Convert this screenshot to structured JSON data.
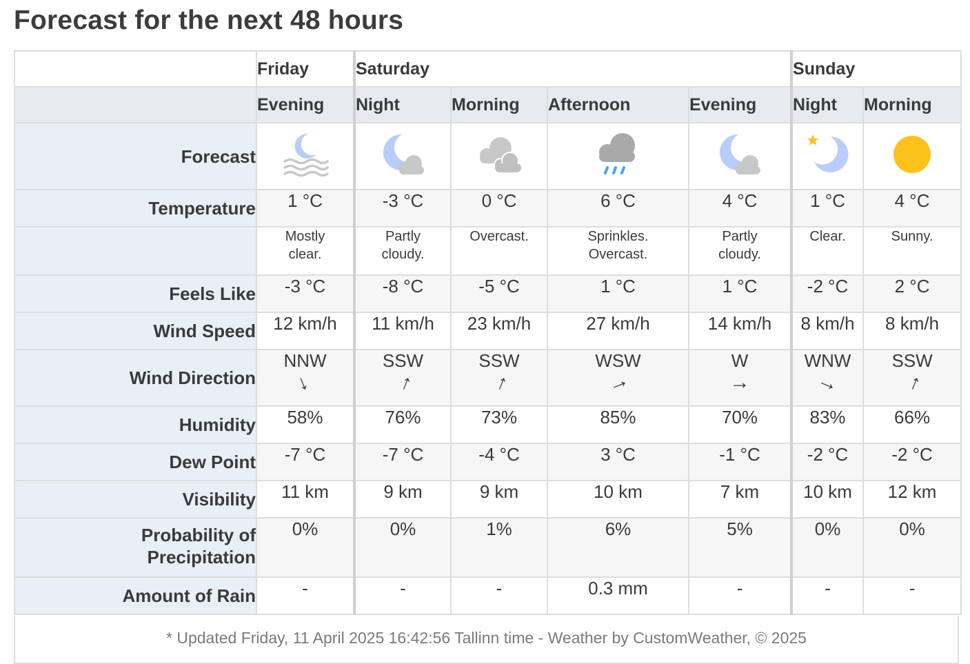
{
  "page": {
    "title": "Forecast for the next 48 hours"
  },
  "days": [
    {
      "label": "Friday"
    },
    {
      "label": "Saturday"
    },
    {
      "label": "Sunday"
    }
  ],
  "periods": [
    {
      "day": "Friday",
      "label": "Evening",
      "icon": "moon-fog-icon",
      "temperature": "1 °C",
      "condition_line1": "Mostly",
      "condition_line2": "clear.",
      "feels_like": "-3 °C",
      "wind_speed": "12 km/h",
      "wind_direction": "NNW",
      "wind_arrow": "→",
      "humidity": "58%",
      "dew_point": "-7 °C",
      "visibility": "11 km",
      "precip_prob": "0%",
      "rain_amount": "-"
    },
    {
      "day": "Saturday",
      "label": "Night",
      "icon": "moon-cloud-icon",
      "temperature": "-3 °C",
      "condition_line1": "Partly",
      "condition_line2": "cloudy.",
      "feels_like": "-8 °C",
      "wind_speed": "11 km/h",
      "wind_direction": "SSW",
      "wind_arrow": "→",
      "humidity": "76%",
      "dew_point": "-7 °C",
      "visibility": "9 km",
      "precip_prob": "0%",
      "rain_amount": "-"
    },
    {
      "day": "Saturday",
      "label": "Morning",
      "icon": "overcast-clouds-icon",
      "temperature": "0 °C",
      "condition_line1": "Overcast.",
      "condition_line2": "",
      "feels_like": "-5 °C",
      "wind_speed": "23 km/h",
      "wind_direction": "SSW",
      "wind_arrow": "→",
      "humidity": "73%",
      "dew_point": "-4 °C",
      "visibility": "9 km",
      "precip_prob": "1%",
      "rain_amount": "-"
    },
    {
      "day": "Saturday",
      "label": "Afternoon",
      "icon": "rain-cloud-icon",
      "temperature": "6 °C",
      "condition_line1": "Sprinkles.",
      "condition_line2": "Overcast.",
      "feels_like": "1 °C",
      "wind_speed": "27 km/h",
      "wind_direction": "WSW",
      "wind_arrow": "→",
      "humidity": "85%",
      "dew_point": "3 °C",
      "visibility": "10 km",
      "precip_prob": "6%",
      "rain_amount": "0.3 mm"
    },
    {
      "day": "Saturday",
      "label": "Evening",
      "icon": "moon-cloud-icon",
      "temperature": "4 °C",
      "condition_line1": "Partly",
      "condition_line2": "cloudy.",
      "feels_like": "1 °C",
      "wind_speed": "14 km/h",
      "wind_direction": "W",
      "wind_arrow": "→",
      "humidity": "70%",
      "dew_point": "-1 °C",
      "visibility": "7 km",
      "precip_prob": "5%",
      "rain_amount": "-"
    },
    {
      "day": "Sunday",
      "label": "Night",
      "icon": "moon-star-icon",
      "temperature": "1 °C",
      "condition_line1": "Clear.",
      "condition_line2": "",
      "feels_like": "-2 °C",
      "wind_speed": "8 km/h",
      "wind_direction": "WNW",
      "wind_arrow": "→",
      "humidity": "83%",
      "dew_point": "-2 °C",
      "visibility": "10 km",
      "precip_prob": "0%",
      "rain_amount": "-"
    },
    {
      "day": "Sunday",
      "label": "Morning",
      "icon": "sun-icon",
      "temperature": "4 °C",
      "condition_line1": "Sunny.",
      "condition_line2": "",
      "feels_like": "2 °C",
      "wind_speed": "8 km/h",
      "wind_direction": "SSW",
      "wind_arrow": "→",
      "humidity": "66%",
      "dew_point": "-2 °C",
      "visibility": "12 km",
      "precip_prob": "0%",
      "rain_amount": "-"
    }
  ],
  "row_labels": {
    "forecast": "Forecast",
    "temperature": "Temperature",
    "condition": "",
    "feels_like": "Feels Like",
    "wind_speed": "Wind Speed",
    "wind_direction": "Wind Direction",
    "humidity": "Humidity",
    "dew_point": "Dew Point",
    "visibility": "Visibility",
    "precip_prob_line1": "Probability of",
    "precip_prob_line2": "Precipitation",
    "rain_amount": "Amount of Rain"
  },
  "colors": {
    "moon": "#b9cdfa",
    "cloud": "#c8c8c8",
    "rain_cloud": "#a9a9a9",
    "rain_drop": "#4aa8e0",
    "sun": "#fcc21b",
    "star": "#fcc21b"
  },
  "footer": {
    "text": "* Updated Friday, 11 April 2025 16:42:56 Tallinn time - Weather by CustomWeather, © 2025"
  }
}
